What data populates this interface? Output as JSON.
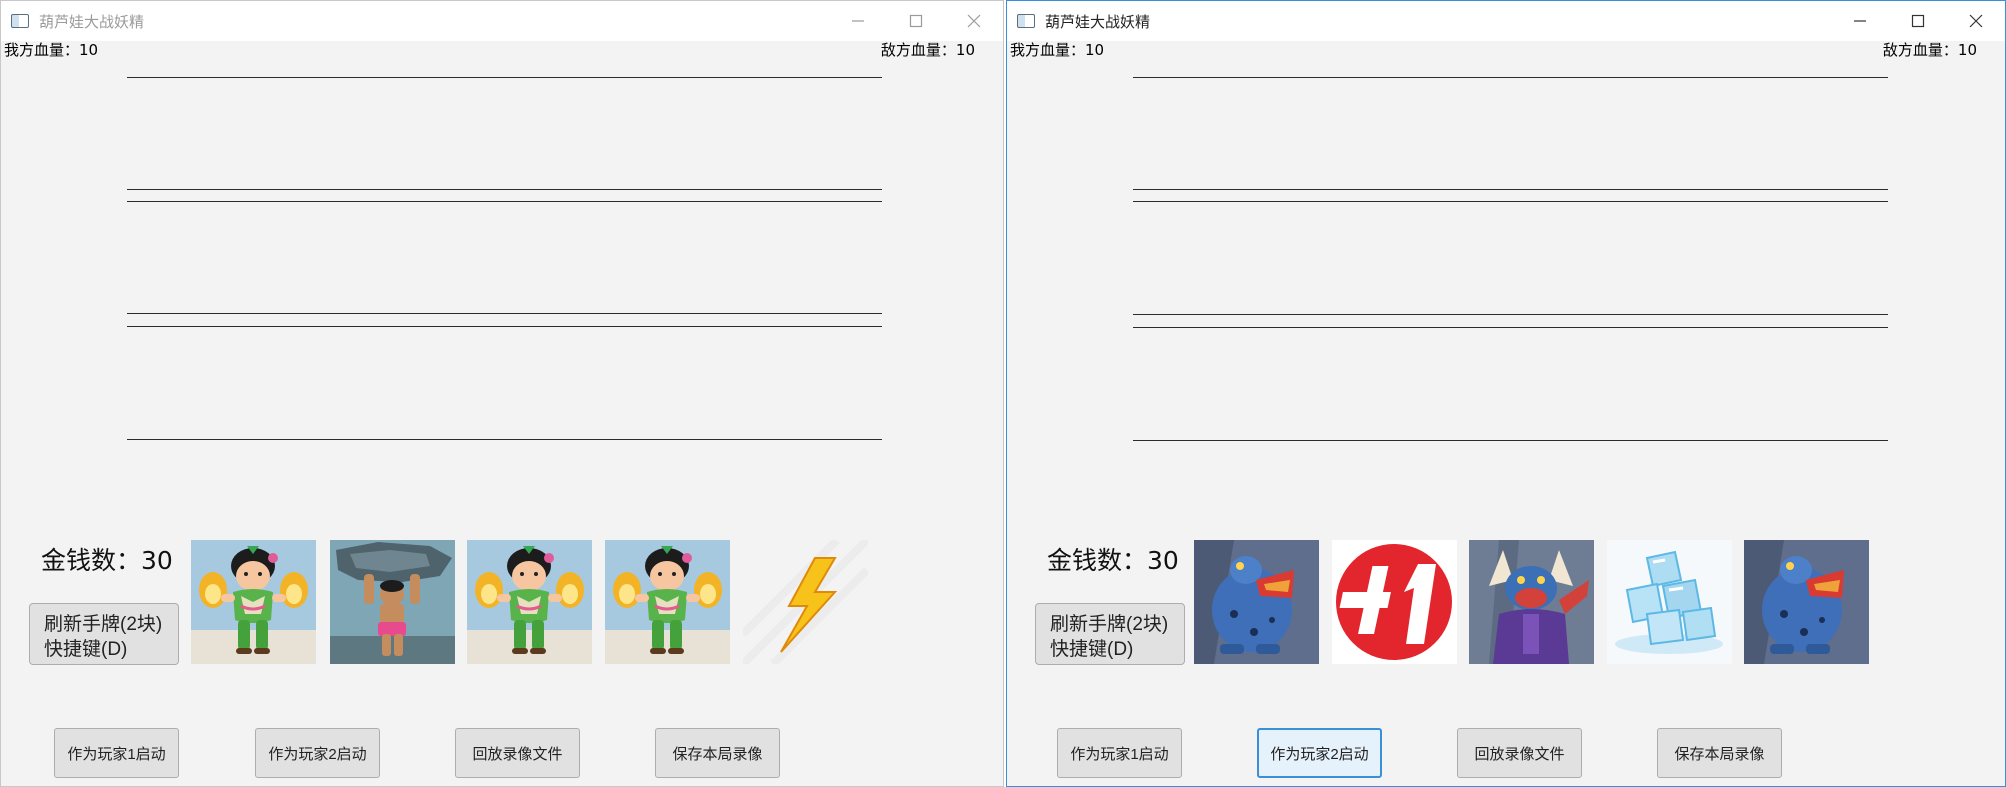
{
  "windows": [
    {
      "title": "葫芦娃大战妖精",
      "my_hp_label": "我方血量：",
      "my_hp_value": "10",
      "enemy_hp_label": "敌方血量：",
      "enemy_hp_value": "10",
      "money_label": "金钱数：",
      "money_value": "30",
      "refresh_line1": "刷新手牌(2块)",
      "refresh_line2": "快捷键(D)",
      "cards": [
        "huluwa-card-icon",
        "rock-brother-card-icon",
        "huluwa-card-icon",
        "huluwa-card-icon",
        "lightning-card-icon"
      ],
      "buttons": [
        "作为玩家1启动",
        "作为玩家2启动",
        "回放录像文件",
        "保存本局录像"
      ]
    },
    {
      "title": "葫芦娃大战妖精",
      "my_hp_label": "我方血量：",
      "my_hp_value": "10",
      "enemy_hp_label": "敌方血量：",
      "enemy_hp_value": "10",
      "money_label": "金钱数：",
      "money_value": "30",
      "refresh_line1": "刷新手牌(2块)",
      "refresh_line2": "快捷键(D)",
      "cards": [
        "toad-demon-card-icon",
        "plus-one-card-icon",
        "scorpion-demon-card-icon",
        "ice-cube-card-icon",
        "toad-demon-card-icon"
      ],
      "buttons": [
        "作为玩家1启动",
        "作为玩家2启动",
        "回放录像文件",
        "保存本局录像"
      ],
      "focused_button": "作为玩家2启动"
    }
  ],
  "colors": {
    "window_bg": "#f3f3f3",
    "focus_blue": "#3a8fd9",
    "button_bg": "#e1e1e1",
    "plus_one_red": "#e3262d"
  }
}
